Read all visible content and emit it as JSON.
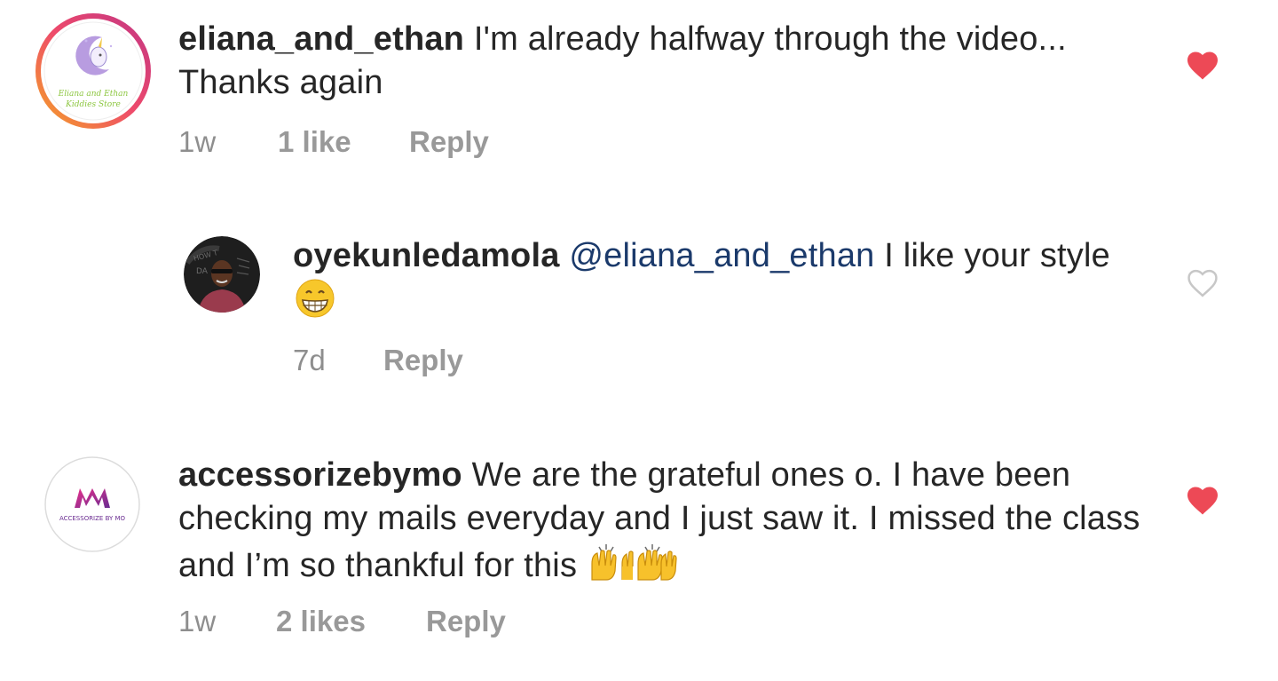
{
  "colors": {
    "username": "#262626",
    "body_text": "#262626",
    "mention": "#1b3a6b",
    "meta": "#8e8e8e",
    "heart_liked": "#ed4956",
    "heart_unliked": "#c7c7c7"
  },
  "comments": [
    {
      "username": "eliana_and_ethan",
      "text": "I'm already halfway through the video... Thanks again",
      "time": "1w",
      "likes": "1 like",
      "reply_label": "Reply",
      "liked": true,
      "avatar_icon": "unicorn-store-logo-icon",
      "avatar_caption": "Eliana and Ethan Kiddies Store"
    },
    {
      "username": "oyekunledamola",
      "mention": "@eliana_and_ethan",
      "text": "I like your style",
      "emoji": "grinning-face-icon",
      "time": "7d",
      "reply_label": "Reply",
      "liked": false,
      "avatar_icon": "profile-photo-icon"
    },
    {
      "username": "accessorizebymo",
      "text": "We are the grateful ones o. I have been checking my mails everyday and I just saw it. I missed the class and I’m so thankful for this",
      "emoji": "raising-hands-icon",
      "time": "1w",
      "likes": "2 likes",
      "reply_label": "Reply",
      "liked": true,
      "avatar_icon": "accessorize-by-mo-logo-icon",
      "avatar_caption": "ACCESSORIZE BY MO"
    }
  ]
}
